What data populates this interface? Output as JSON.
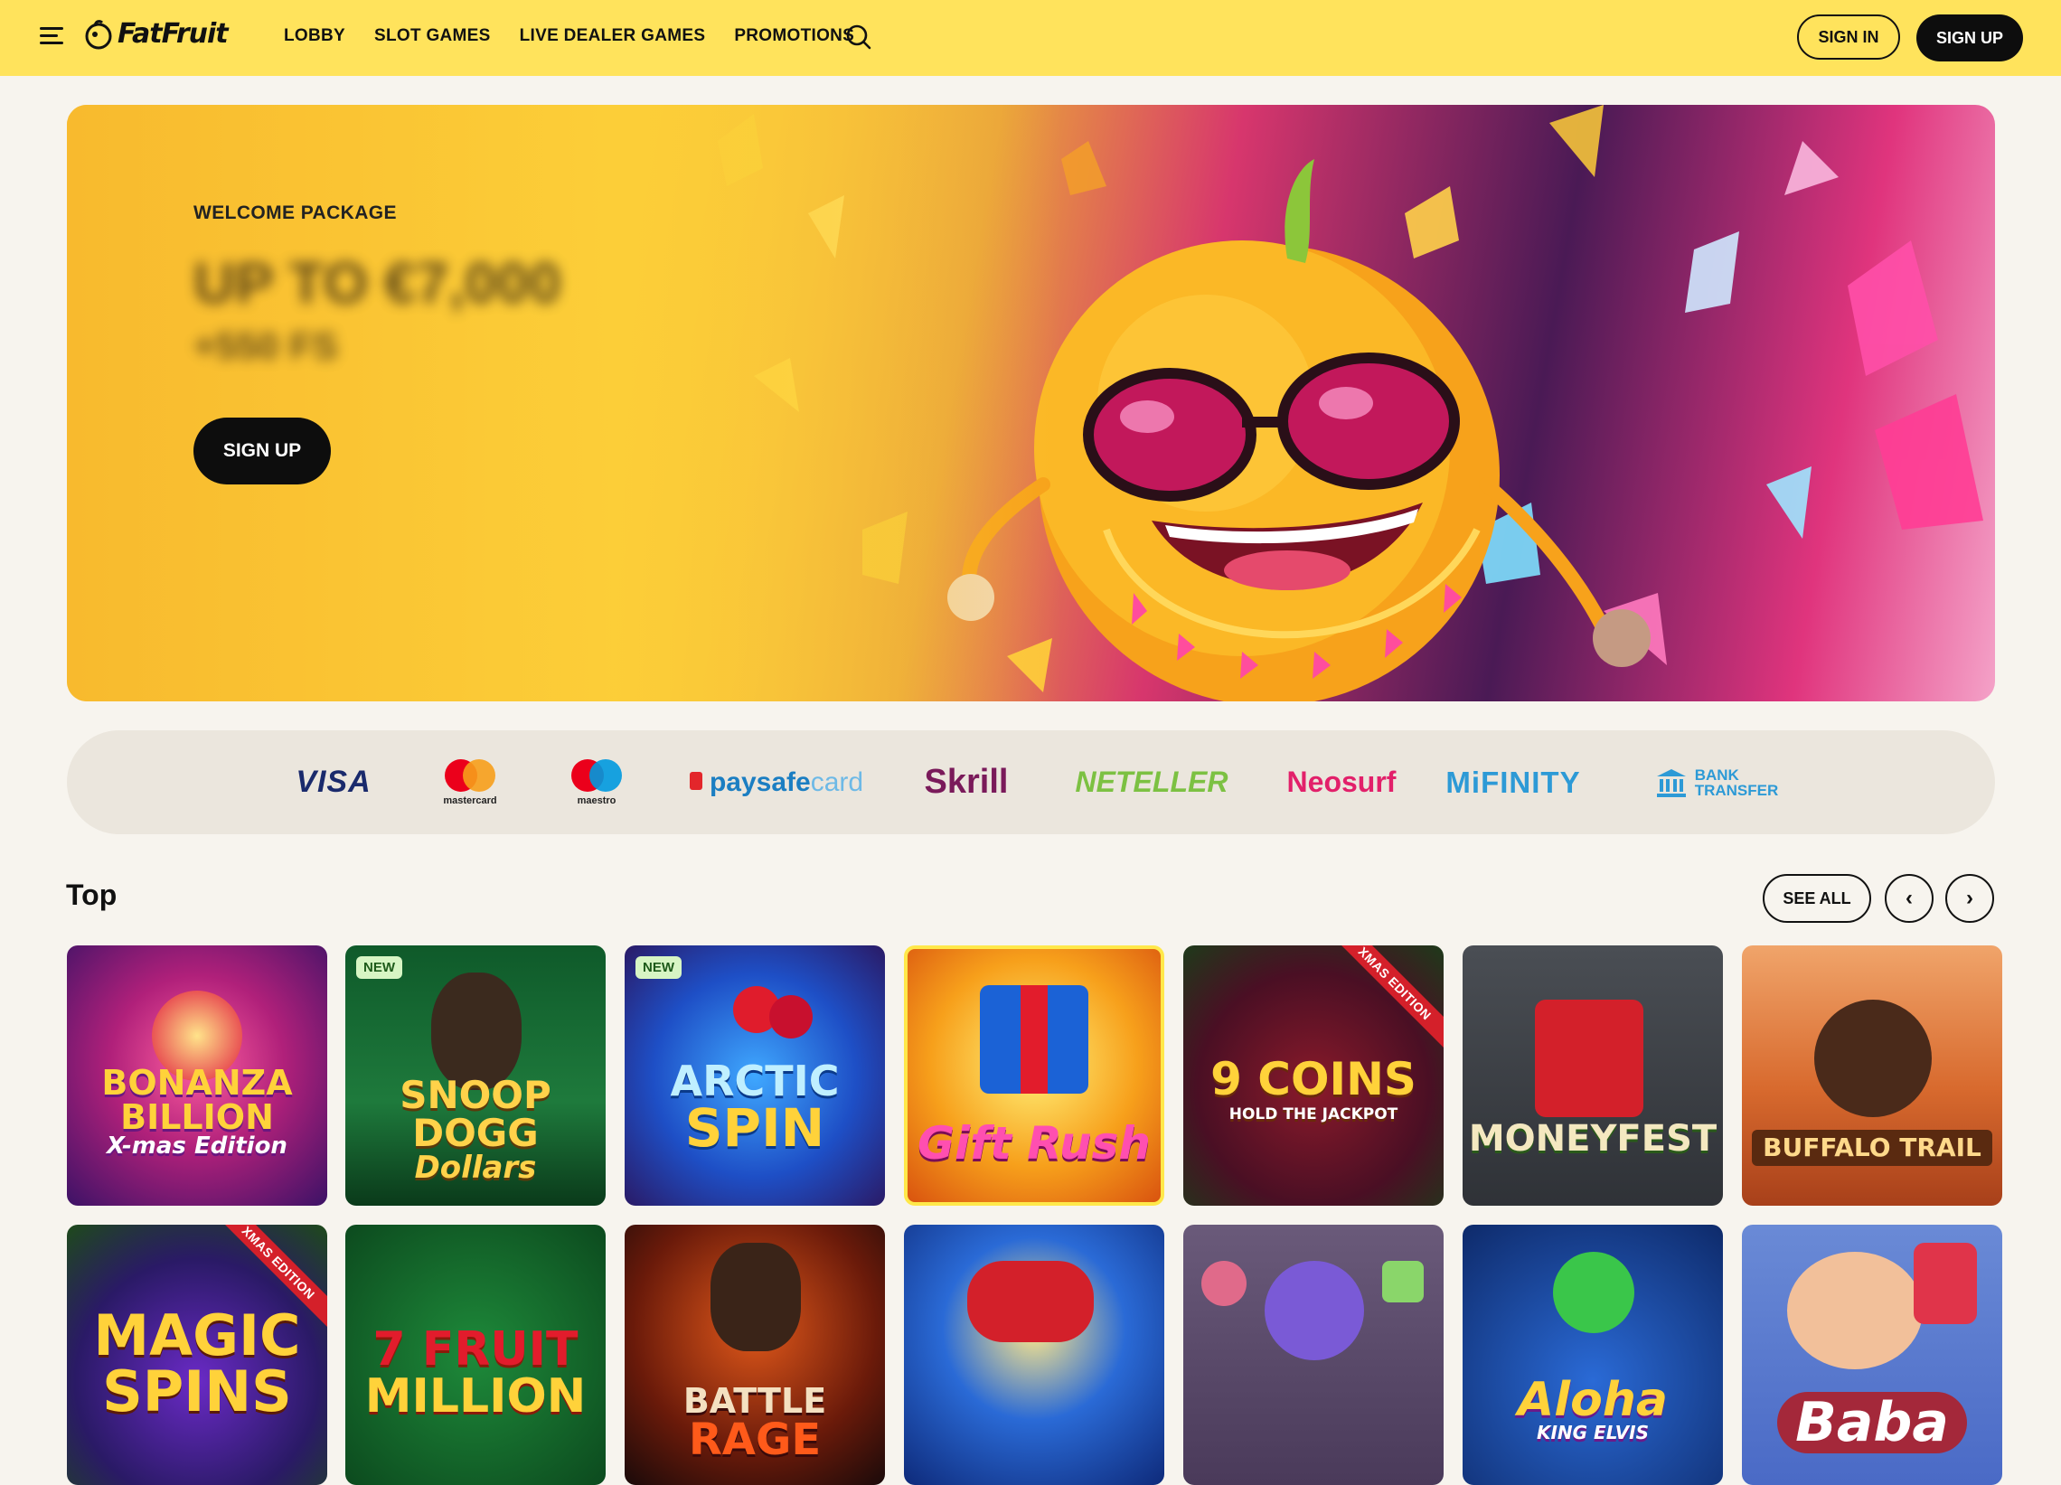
{
  "header": {
    "logo_text": "FatFruit",
    "nav": [
      "LOBBY",
      "SLOT GAMES",
      "LIVE DEALER GAMES",
      "PROMOTIONS"
    ],
    "sign_in": "SIGN IN",
    "sign_up": "SIGN UP",
    "icons": [
      "menu-icon",
      "search-icon"
    ]
  },
  "hero": {
    "kicker": "WELCOME PACKAGE",
    "amount_blurred": "UP TO €7,000",
    "sub_blurred": "+550 FS",
    "button": "SIGN UP"
  },
  "payments": {
    "visa": "VISA",
    "mastercard": "mastercard",
    "maestro": "maestro",
    "paysafecard_a": "paysafe",
    "paysafecard_b": "card",
    "skrill": "Skrill",
    "neteller": "NETELLER",
    "neosurf": "Neosurf",
    "mifinity": "MiFINITY",
    "bank_line1": "BANK",
    "bank_line2": "TRANSFER"
  },
  "top": {
    "title": "Top",
    "see_all": "SEE ALL",
    "prev": "‹",
    "next": "›",
    "badge_new": "NEW",
    "ribbon_xmas": "XMAS EDITION",
    "games": [
      {
        "title": "BONANZA BILLION",
        "sub": "X-mas Edition"
      },
      {
        "title": "SNOOP DOGG",
        "sub": "Dollars"
      },
      {
        "title": "ARCTIC",
        "sub": "SPIN"
      },
      {
        "title": "Gift Rush",
        "sub": ""
      },
      {
        "title": "9 COINS",
        "sub": "HOLD THE JACKPOT"
      },
      {
        "title": "MONEYFEST",
        "sub": ""
      },
      {
        "title": "BUFFALO TRAIL",
        "sub": ""
      },
      {
        "title": "MAGIC",
        "sub": "SPINS"
      },
      {
        "title": "7 FRUIT",
        "sub": "MILLION"
      },
      {
        "title": "BATTLE",
        "sub": "RAGE"
      },
      {
        "title": "",
        "sub": ""
      },
      {
        "title": "",
        "sub": ""
      },
      {
        "title": "Aloha",
        "sub": "KING ELVIS"
      },
      {
        "title": "Baba",
        "sub": ""
      }
    ]
  },
  "colors": {
    "header_bg": "#ffe35c",
    "page_bg": "#f7f4ee",
    "button_dark": "#0d0d0d",
    "payments_bg": "#ebe6dd"
  }
}
